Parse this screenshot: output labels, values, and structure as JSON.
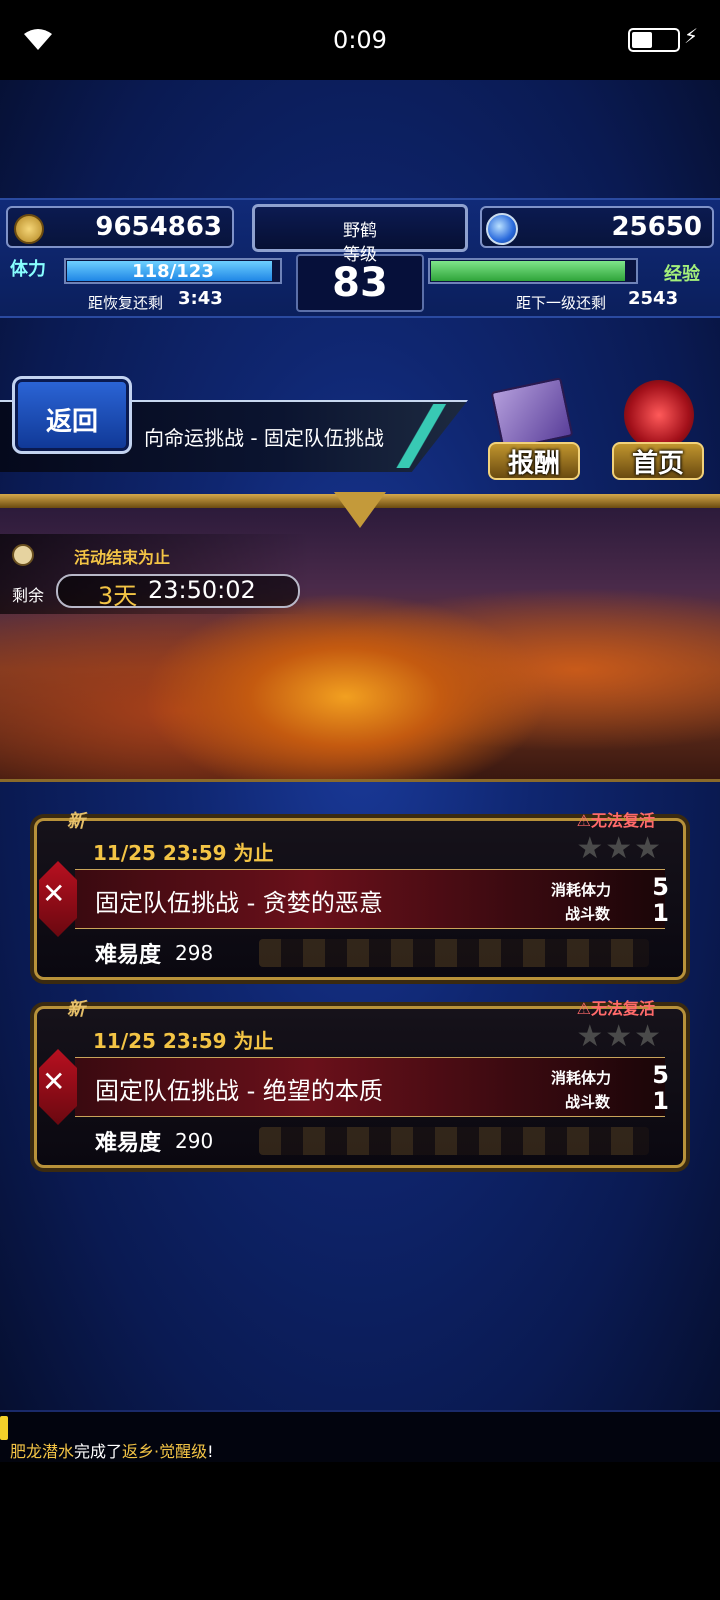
{
  "status_bar": {
    "time": "0:09"
  },
  "hud": {
    "gil": "9654863",
    "gems": "25650",
    "player_name": "野鹤",
    "rank_label": "等级",
    "level": "83",
    "stamina_label": "体力",
    "stamina": "118/123",
    "stamina_fraction": 0.959,
    "recover_label": "距恢复还剩",
    "recover_time": "3:43",
    "exp_label": "经验",
    "exp_fraction": 0.94,
    "next_level_label": "距下一级还剩",
    "next_level_value": "2543"
  },
  "nav": {
    "back_label": "返回",
    "title": "向命运挑战 - 固定队伍挑战",
    "reward_label": "报酬",
    "home_label": "首页"
  },
  "banner": {
    "event_end_label": "活动结束为止",
    "remain_label": "剩余",
    "days": "3天",
    "time": "23:50:02"
  },
  "quests": [
    {
      "new_badge": "新",
      "no_revive": "⚠无法复活",
      "stars": "★★★",
      "deadline": "11/25 23:59 为止",
      "title": "固定队伍挑战 - 贪婪的恶意",
      "cost_label": "消耗体力",
      "cost": "5",
      "battle_label": "战斗数",
      "battles": "1",
      "difficulty_label": "难易度",
      "difficulty": "298"
    },
    {
      "new_badge": "新",
      "no_revive": "⚠无法复活",
      "stars": "★★★",
      "deadline": "11/25 23:59 为止",
      "title": "固定队伍挑战 - 绝望的本质",
      "cost_label": "消耗体力",
      "cost": "5",
      "battle_label": "战斗数",
      "battles": "1",
      "difficulty_label": "难易度",
      "difficulty": "290"
    }
  ],
  "ticker": {
    "name": "肥龙潜水",
    "middle": "完成了",
    "item": "返乡·觉醒级",
    "end": "!"
  }
}
